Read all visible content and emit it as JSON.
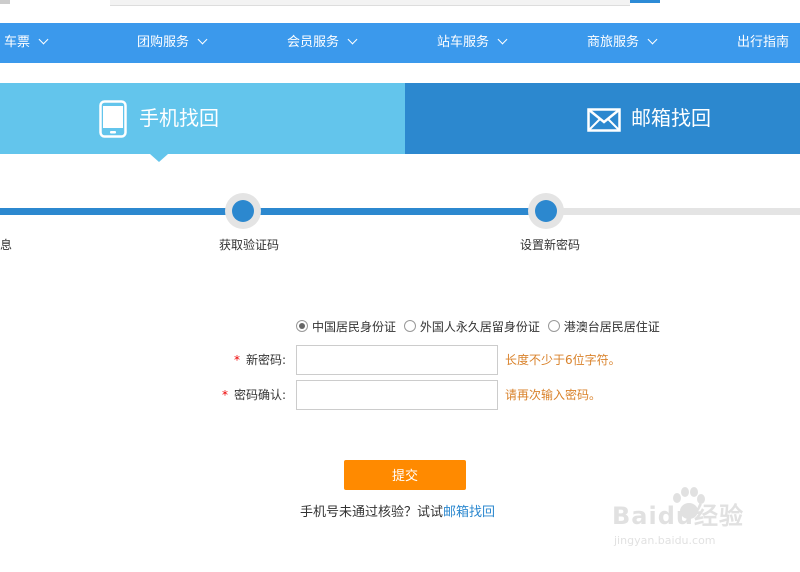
{
  "nav": {
    "items": [
      {
        "label": "车票"
      },
      {
        "label": "团购服务"
      },
      {
        "label": "会员服务"
      },
      {
        "label": "站车服务"
      },
      {
        "label": "商旅服务"
      },
      {
        "label": "出行指南"
      }
    ]
  },
  "tabs": {
    "phone": {
      "label": "手机找回",
      "icon": "phone-icon"
    },
    "email": {
      "label": "邮箱找回",
      "icon": "mail-icon"
    }
  },
  "steps": [
    {
      "label": "息"
    },
    {
      "label": "获取验证码"
    },
    {
      "label": "设置新密码"
    }
  ],
  "form": {
    "id_types": [
      {
        "label": "中国居民身份证",
        "checked": true
      },
      {
        "label": "外国人永久居留身份证",
        "checked": false
      },
      {
        "label": "港澳台居民居住证",
        "checked": false
      }
    ],
    "required_mark": "*",
    "new_password": {
      "label": "新密码:",
      "value": "",
      "hint": "长度不少于6位字符。"
    },
    "confirm_password": {
      "label": "密码确认:",
      "value": "",
      "hint": "请再次输入密码。"
    },
    "submit_label": "提交",
    "bottom_note": "手机号未通过核验？试试",
    "bottom_link": "邮箱找回"
  },
  "watermark": {
    "main": "Baidu经验",
    "sub": "jingyan.baidu.com"
  },
  "colors": {
    "nav_bg": "#3b99ec",
    "tab_phone_bg": "#63c5ec",
    "tab_email_bg": "#2c88cf",
    "progress_active": "#2c88cf",
    "progress_inactive": "#e4e4e4",
    "submit_bg": "#ff8a00",
    "hint": "#d9822b",
    "required": "#ee0000"
  }
}
